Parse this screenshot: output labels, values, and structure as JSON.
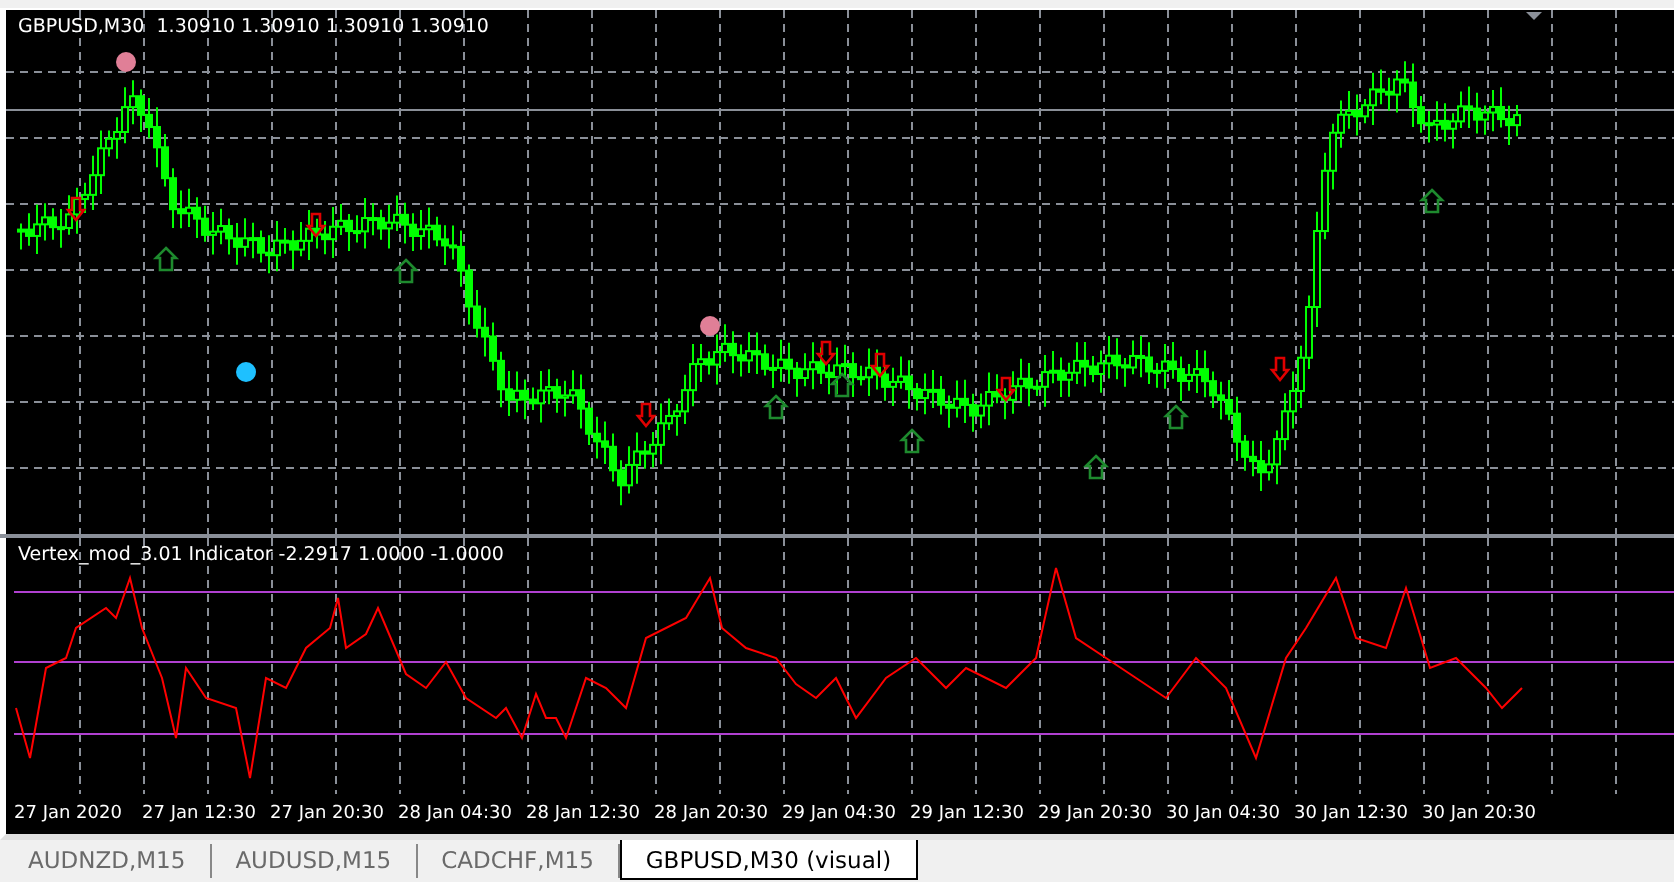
{
  "chart": {
    "symbol": "GBPUSD,M30",
    "prices": "1.30910 1.30910 1.30910 1.30910"
  },
  "indicator": {
    "label": "Vertex_mod_3.01 Indicator -2.2917 1.0000 -1.0000"
  },
  "time_axis": [
    "27 Jan 2020",
    "27 Jan 12:30",
    "27 Jan 20:30",
    "28 Jan 04:30",
    "28 Jan 12:30",
    "28 Jan 20:30",
    "29 Jan 04:30",
    "29 Jan 12:30",
    "29 Jan 20:30",
    "30 Jan 04:30",
    "30 Jan 12:30",
    "30 Jan 20:30"
  ],
  "tabs": [
    {
      "label": "AUDNZD,M15",
      "selected": false
    },
    {
      "label": "AUDUSD,M15",
      "selected": false
    },
    {
      "label": "CADCHF,M15",
      "selected": false
    },
    {
      "label": "GBPUSD,M30 (visual)",
      "selected": true
    }
  ]
}
